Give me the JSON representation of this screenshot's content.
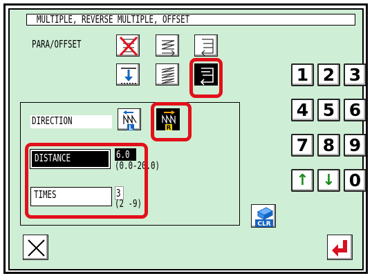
{
  "header": {
    "title": "MULTIPLE, REVERSE MULTIPLE, OFFSET"
  },
  "para_offset": {
    "label": "PARA/OFFSET",
    "options": [
      {
        "icon": "disabled-cross-icon"
      },
      {
        "icon": "parallel-arrow-icon"
      },
      {
        "icon": "reverse-parallel-icon"
      },
      {
        "icon": "offset-down-icon"
      },
      {
        "icon": "multi-zigzag-icon"
      },
      {
        "icon": "reverse-return-icon",
        "selected": true
      }
    ]
  },
  "direction": {
    "label": "DIRECTION",
    "left_badge": "L",
    "right_badge": "R",
    "selected": "R"
  },
  "distance": {
    "label": "DISTANCE",
    "value": "6.0",
    "range": "(0.0-20.0)"
  },
  "times": {
    "label": "TIMES",
    "value": "3",
    "range": "(2 -9)"
  },
  "keypad": {
    "keys": [
      "1",
      "2",
      "3",
      "4",
      "5",
      "6",
      "7",
      "8",
      "9",
      "↑",
      "↓",
      "0"
    ],
    "clear_label": "CLR"
  },
  "colors": {
    "panel_bg": "#cfeed6",
    "highlight": "#e2101a",
    "icon_blue": "#1565c0",
    "arrow_green": "#1a8a1a",
    "enter_red": "#d81020",
    "badge_yellow": "#f2d000"
  }
}
